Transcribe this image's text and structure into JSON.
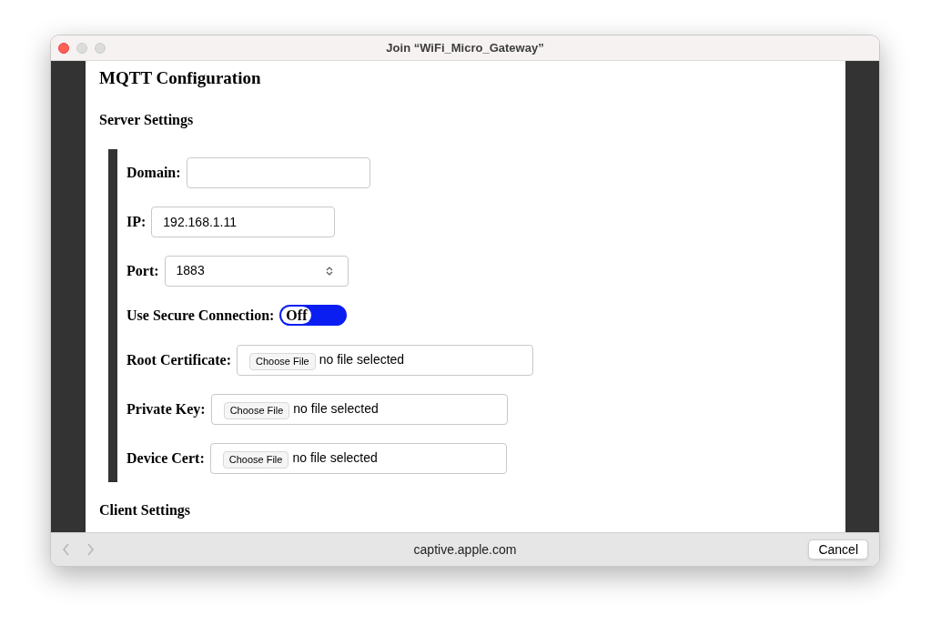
{
  "window": {
    "title": "Join “WiFi_Micro_Gateway”"
  },
  "page": {
    "heading": "MQTT Configuration",
    "sections": [
      {
        "title": "Server Settings",
        "fields": [
          {
            "kind": "text",
            "label": "Domain:"
          },
          {
            "kind": "text",
            "label": "IP:",
            "value": "192.168.1.11"
          },
          {
            "kind": "number",
            "label": "Port:",
            "value": "1883"
          },
          {
            "kind": "toggle",
            "label": "Use Secure Connection:",
            "on": false,
            "state_label": "Off"
          },
          {
            "kind": "file",
            "label": "Root Certificate:",
            "button": "Choose File",
            "status": "no file selected"
          },
          {
            "kind": "file",
            "label": "Private Key:",
            "button": "Choose File",
            "status": "no file selected"
          },
          {
            "kind": "file",
            "label": "Device Cert:",
            "button": "Choose File",
            "status": "no file selected"
          }
        ]
      },
      {
        "title": "Client Settings"
      }
    ]
  },
  "bottom_bar": {
    "url": "captive.apple.com",
    "cancel": "Cancel"
  }
}
